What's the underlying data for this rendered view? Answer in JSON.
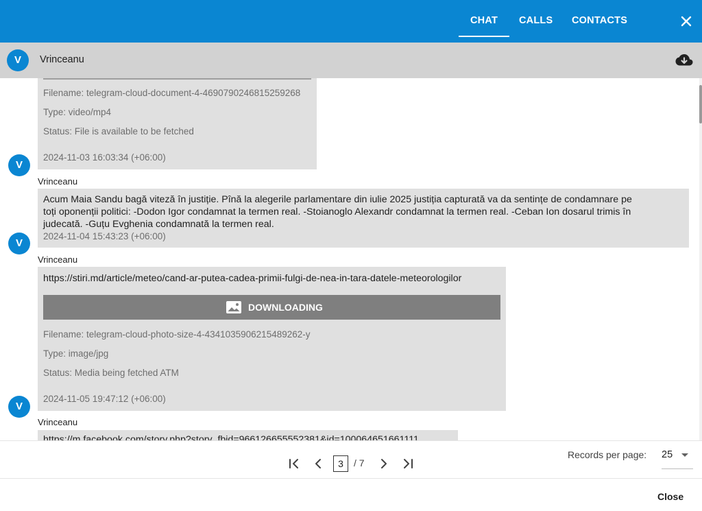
{
  "tabs": [
    "CHAT",
    "CALLS",
    "CONTACTS"
  ],
  "active_tab": "CHAT",
  "header": {
    "avatar_letter": "V",
    "name": "Vrinceanu"
  },
  "messages": [
    {
      "filename": "Filename: telegram-cloud-document-4-4690790246815259268",
      "type": "Type: video/mp4",
      "status": "Status: File is available to be fetched",
      "timestamp": "2024-11-03 16:03:34 (+06:00)",
      "avatar": "V"
    },
    {
      "sender": "Vrinceanu",
      "text_lines": [
        "Acum Maia Sandu bagă viteză în justiție. Pînă la alegerile parlamentare din iulie 2025 justiția capturată va da sentințe de condamnare pe",
        "toți oponenții politici: -Dodon Igor condamnat la termen real. -Stoianoglo Alexandr condamnat la termen real. -Ceban Ion dosarul trimis în",
        "judecată. -Guțu Evghenia condamnată la termen real."
      ],
      "timestamp": "2024-11-04 15:43:23 (+06:00)",
      "avatar": "V"
    },
    {
      "sender": "Vrinceanu",
      "link": "https://stiri.md/article/meteo/cand-ar-putea-cadea-primii-fulgi-de-nea-in-tara-datele-meteorologilor",
      "download_label": "DOWNLOADING",
      "filename": "Filename: telegram-cloud-photo-size-4-4341035906215489262-y",
      "type": "Type: image/jpg",
      "status": "Status: Media being fetched ATM",
      "timestamp": "2024-11-05 19:47:12 (+06:00)",
      "avatar": "V"
    },
    {
      "sender": "Vrinceanu",
      "link_partial": "https://m.facebook.com/story.php?story_fbid=966126655552381&id=100064651661111"
    }
  ],
  "pagination": {
    "current_page": "3",
    "total": "/ 7",
    "records_label": "Records per page:",
    "records_value": "25"
  },
  "footer": {
    "close_label": "Close"
  },
  "colors": {
    "primary": "#0a86d2",
    "bubble": "#e0e0e0",
    "header_bg": "#d2d2d2",
    "download_btn": "#7f7f7f"
  }
}
